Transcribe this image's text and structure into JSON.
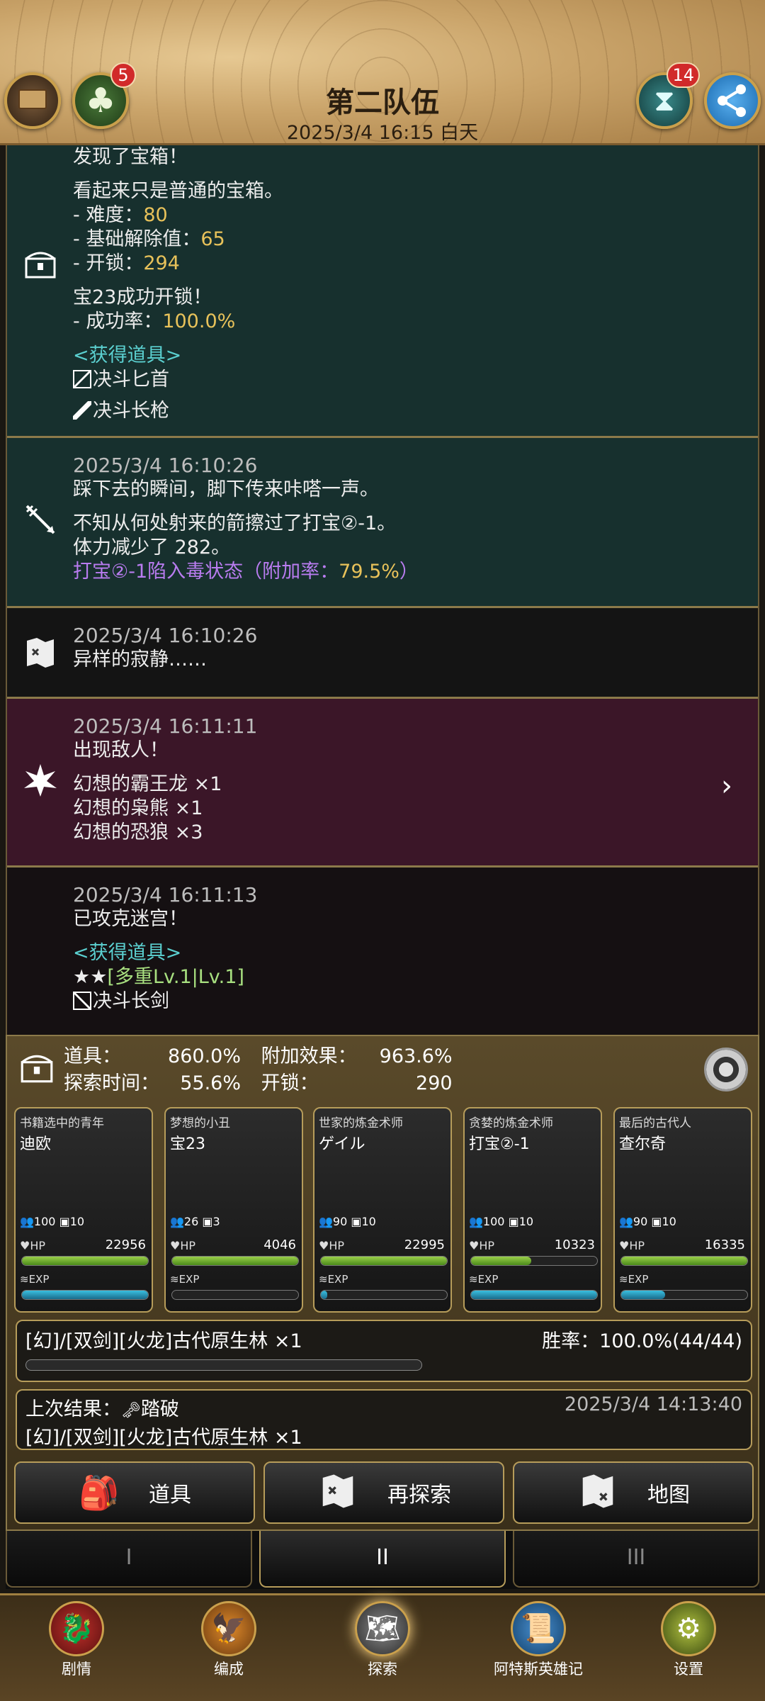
{
  "header": {
    "title": "第二队伍",
    "datetime": "2025/3/4 16:15 白天",
    "clover_badge": "5",
    "hourglass_badge": "14"
  },
  "log": {
    "chest": {
      "line1": "发现了宝箱！",
      "line2": "看起来只是普通的宝箱。",
      "diff_label": "- 难度：",
      "diff_val": "80",
      "base_label": "- 基础解除值：",
      "base_val": "65",
      "unlock_label": "- 开锁：",
      "unlock_val": "294",
      "success_line": "宝23成功开锁！",
      "rate_label": "- 成功率：",
      "rate_val": "100.0%",
      "items_header": "<获得道具>",
      "item1": "决斗匕首",
      "item2": "决斗长枪"
    },
    "trap": {
      "ts": "2025/3/4 16:10:26",
      "line1": "踩下去的瞬间，脚下传来咔嗒一声。",
      "line2": "不知从何处射来的箭擦过了打宝②-1。",
      "line3": "体力减少了 282。",
      "poison_a": "打宝②-1陷入毒状态（附加率：",
      "poison_val": "79.5%",
      "poison_b": "）"
    },
    "quiet": {
      "ts": "2025/3/4 16:10:26",
      "line1": "异样的寂静……"
    },
    "enemy": {
      "ts": "2025/3/4 16:11:11",
      "line1": "出现敌人！",
      "e1": "幻想的霸王龙 ×1",
      "e2": "幻想的枭熊 ×1",
      "e3": "幻想的恐狼 ×3"
    },
    "clear": {
      "ts": "2025/3/4 16:11:13",
      "line1": "已攻克迷宫！",
      "items_header": "<获得道具>",
      "star": "★★",
      "item1": "[多重Lv.1|Lv.1]",
      "item2": "决斗长剑"
    }
  },
  "stats": {
    "item_label": "道具：",
    "item_val": "860.0%",
    "effect_label": "附加效果：",
    "effect_val": "963.6%",
    "time_label": "探索时间：",
    "time_val": "55.6%",
    "unlock_label": "开锁：",
    "unlock_val": "290"
  },
  "members": [
    {
      "title": "书籍选中的青年",
      "name": "迪欧",
      "s1": "100",
      "s2": "10",
      "hp": "22956",
      "hp_frac": 1.0,
      "exp_frac": 1.0
    },
    {
      "title": "梦想的小丑",
      "name": "宝23",
      "s1": "26",
      "s2": "3",
      "hp": "4046",
      "hp_frac": 1.0,
      "exp_frac": 0.0
    },
    {
      "title": "世家的炼金术师",
      "name": "ゲイル",
      "s1": "90",
      "s2": "10",
      "hp": "22995",
      "hp_frac": 1.0,
      "exp_frac": 0.05
    },
    {
      "title": "贪婪的炼金术师",
      "name": "打宝②-1",
      "s1": "100",
      "s2": "10",
      "hp": "10323",
      "hp_frac": 0.48,
      "exp_frac": 1.0
    },
    {
      "title": "最后的古代人",
      "name": "查尔奇",
      "s1": "90",
      "s2": "10",
      "hp": "16335",
      "hp_frac": 1.0,
      "exp_frac": 0.35
    }
  ],
  "labels": {
    "hp": "HP",
    "exp": "EXP"
  },
  "dungeon": {
    "name": "[幻]/[双剑][火龙]古代原生林 ×1",
    "win_rate": "胜率：100.0%(44/44)"
  },
  "last": {
    "label": "上次结果：",
    "result": "踏破",
    "time": "2025/3/4 14:13:40",
    "name": "[幻]/[双剑][火龙]古代原生林 ×1"
  },
  "buttons": {
    "items": "道具",
    "re_explore": "再探索",
    "map": "地图"
  },
  "tabs": [
    "I",
    "II",
    "III"
  ],
  "nav": [
    "剧情",
    "编成",
    "探索",
    "阿特斯英雄记",
    "设置"
  ]
}
